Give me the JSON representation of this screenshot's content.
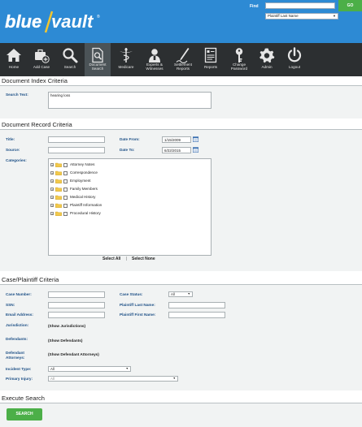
{
  "header": {
    "logo_text": "blue vault",
    "find_label": "Find",
    "find_value": "",
    "find_select": "Plaintiff Last Name",
    "go_label": "GO"
  },
  "nav": [
    {
      "label": "Home",
      "icon": "home-icon"
    },
    {
      "label": "Add Case",
      "icon": "add-case-icon"
    },
    {
      "label": "Search",
      "icon": "search-icon"
    },
    {
      "label": "Document Search",
      "icon": "document-search-icon",
      "active": true
    },
    {
      "label": "Medicare",
      "icon": "medicare-icon"
    },
    {
      "label": "Experts & Witnesses",
      "icon": "experts-icon"
    },
    {
      "label": "Settlement Reports",
      "icon": "settlement-icon"
    },
    {
      "label": "Reports",
      "icon": "reports-icon"
    },
    {
      "label": "Change Password",
      "icon": "key-icon"
    },
    {
      "label": "Admin",
      "icon": "gear-icon"
    },
    {
      "label": "Logout",
      "icon": "power-icon"
    }
  ],
  "index": {
    "title": "Document Index Criteria",
    "search_text_label": "Search Text:",
    "search_text_value": "hearing loss"
  },
  "record": {
    "title": "Document Record Criteria",
    "title_label": "Title:",
    "source_label": "Source:",
    "categories_label": "Categories:",
    "date_from_label": "Date From:",
    "date_from_value": "1/15/2009",
    "date_to_label": "Date To:",
    "date_to_value": "6/22/2015",
    "categories": [
      "Attorney Notes",
      "Correspondence",
      "Employment",
      "Family Members",
      "Medical History",
      "Plaintiff Information",
      "Procedural History"
    ],
    "select_all": "Select All",
    "separator": "|",
    "select_none": "Select None"
  },
  "case": {
    "title": "Case/Plaintiff Criteria",
    "case_number_label": "Case Number:",
    "ssn_label": "SSN:",
    "email_label": "Email Address:",
    "jurisdiction_label": "Jurisdiction:",
    "jurisdiction_link": "(Show Jurisdictions)",
    "defendants_label": "Defendants:",
    "defendants_link": "(Show Defendants)",
    "defendant_attorneys_label": "Defendant Attorneys:",
    "defendant_attorneys_link": "(Show Defendant Attorneys)",
    "incident_type_label": "Incident Type:",
    "incident_type_value": "All",
    "primary_injury_label": "Primary Injury:",
    "primary_injury_value": "All",
    "case_status_label": "Case Status:",
    "case_status_value": "All",
    "plaintiff_last_label": "Plaintiff Last Name:",
    "plaintiff_first_label": "Plaintiff First Name:"
  },
  "execute": {
    "title": "Execute Search",
    "search_label": "SEARCH"
  },
  "colors": {
    "header_blue": "#2d8ad4",
    "nav_dark": "#2c2f31",
    "accent_green": "#4caf48",
    "label_blue": "#1c4f86"
  }
}
